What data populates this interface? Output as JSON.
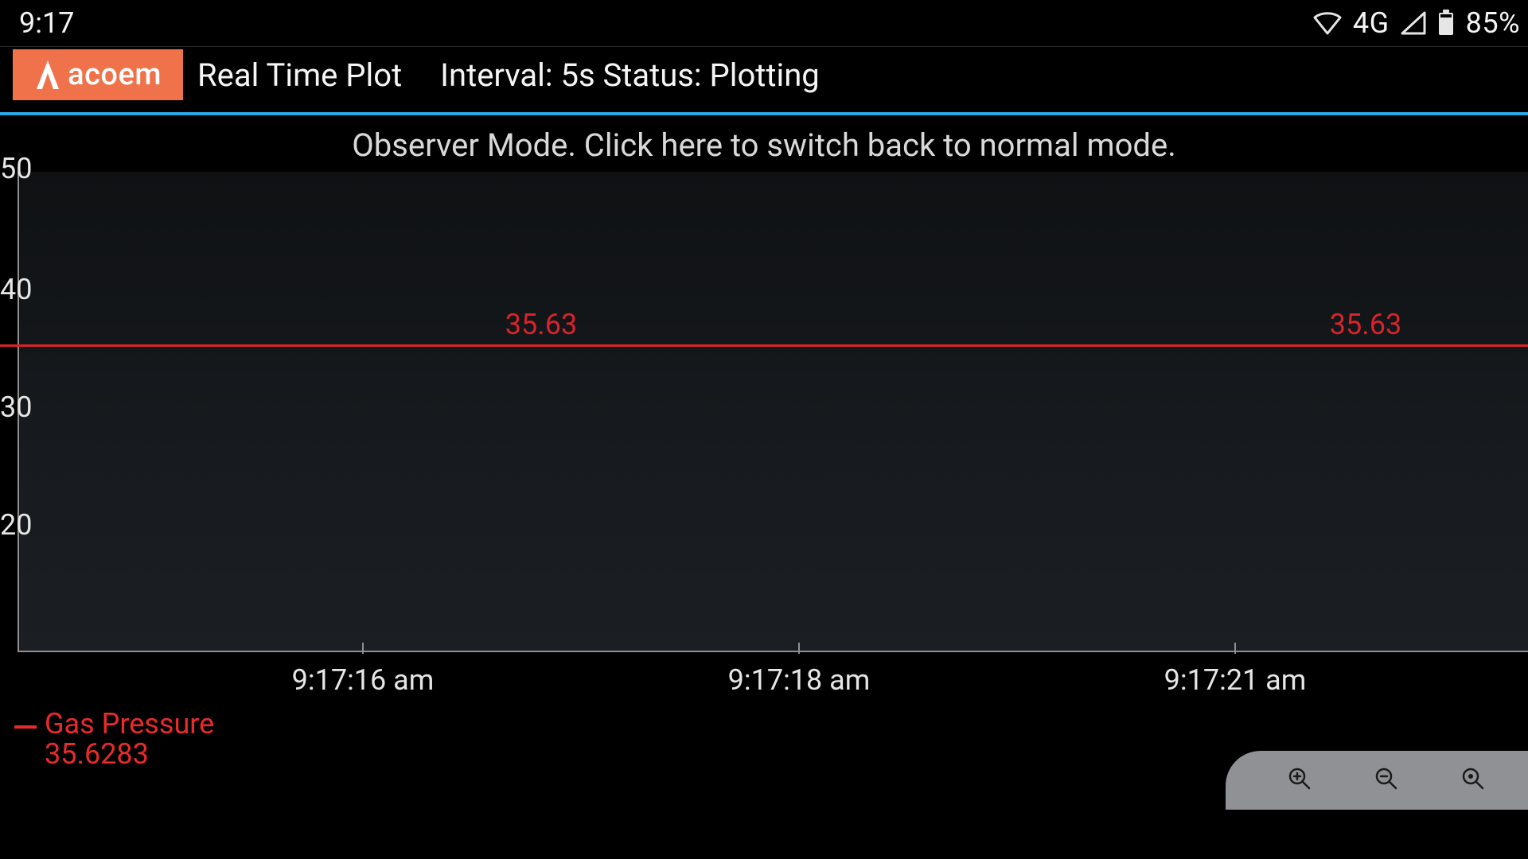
{
  "statusbar": {
    "time": "9:17",
    "network_label": "4G",
    "battery_text": "85%"
  },
  "brand": {
    "name": "acoem"
  },
  "appbar": {
    "title": "Real Time Plot",
    "subtitle": "Interval: 5s Status: Plotting"
  },
  "banner": {
    "text": "Observer Mode. Click here to switch back to normal mode."
  },
  "legend": {
    "series_name": "Gas Pressure",
    "current_value": "35.6283",
    "color": "#ea2a2a"
  },
  "chart_data": {
    "type": "line",
    "title": "",
    "xlabel": "",
    "ylabel": "",
    "ylim": [
      10,
      50
    ],
    "y_ticks": [
      50,
      40,
      30,
      20
    ],
    "x_ticks": [
      "9:17:16 am",
      "9:17:18 am",
      "9:17:21 am"
    ],
    "series": [
      {
        "name": "Gas Pressure",
        "color": "#d7242a",
        "x": [
          "9:17:16 am",
          "9:17:18 am",
          "9:17:21 am"
        ],
        "values": [
          35.63,
          35.63,
          35.63
        ],
        "point_labels": [
          "35.63",
          "35.63"
        ]
      }
    ]
  }
}
